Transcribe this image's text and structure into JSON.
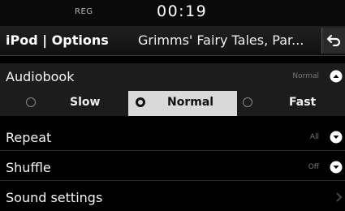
{
  "status": {
    "reg": "REG",
    "time": "00:19"
  },
  "header": {
    "title": "iPod | Options",
    "subtitle": "Grimms' Fairy Tales, Par...",
    "back_icon": "back-arrow-icon"
  },
  "menu": {
    "audiobook": {
      "label": "Audiobook",
      "value": "Normal",
      "expanded": true,
      "options": [
        {
          "label": "Slow",
          "selected": false
        },
        {
          "label": "Normal",
          "selected": true
        },
        {
          "label": "Fast",
          "selected": false
        }
      ]
    },
    "repeat": {
      "label": "Repeat",
      "value": "All"
    },
    "shuffle": {
      "label": "Shuffle",
      "value": "Off"
    },
    "sound_settings": {
      "label": "Sound settings"
    }
  },
  "colors": {
    "background": "#000000",
    "selected_option": "#d9d9d9",
    "text": "#ffffff",
    "value_text": "#777777"
  }
}
